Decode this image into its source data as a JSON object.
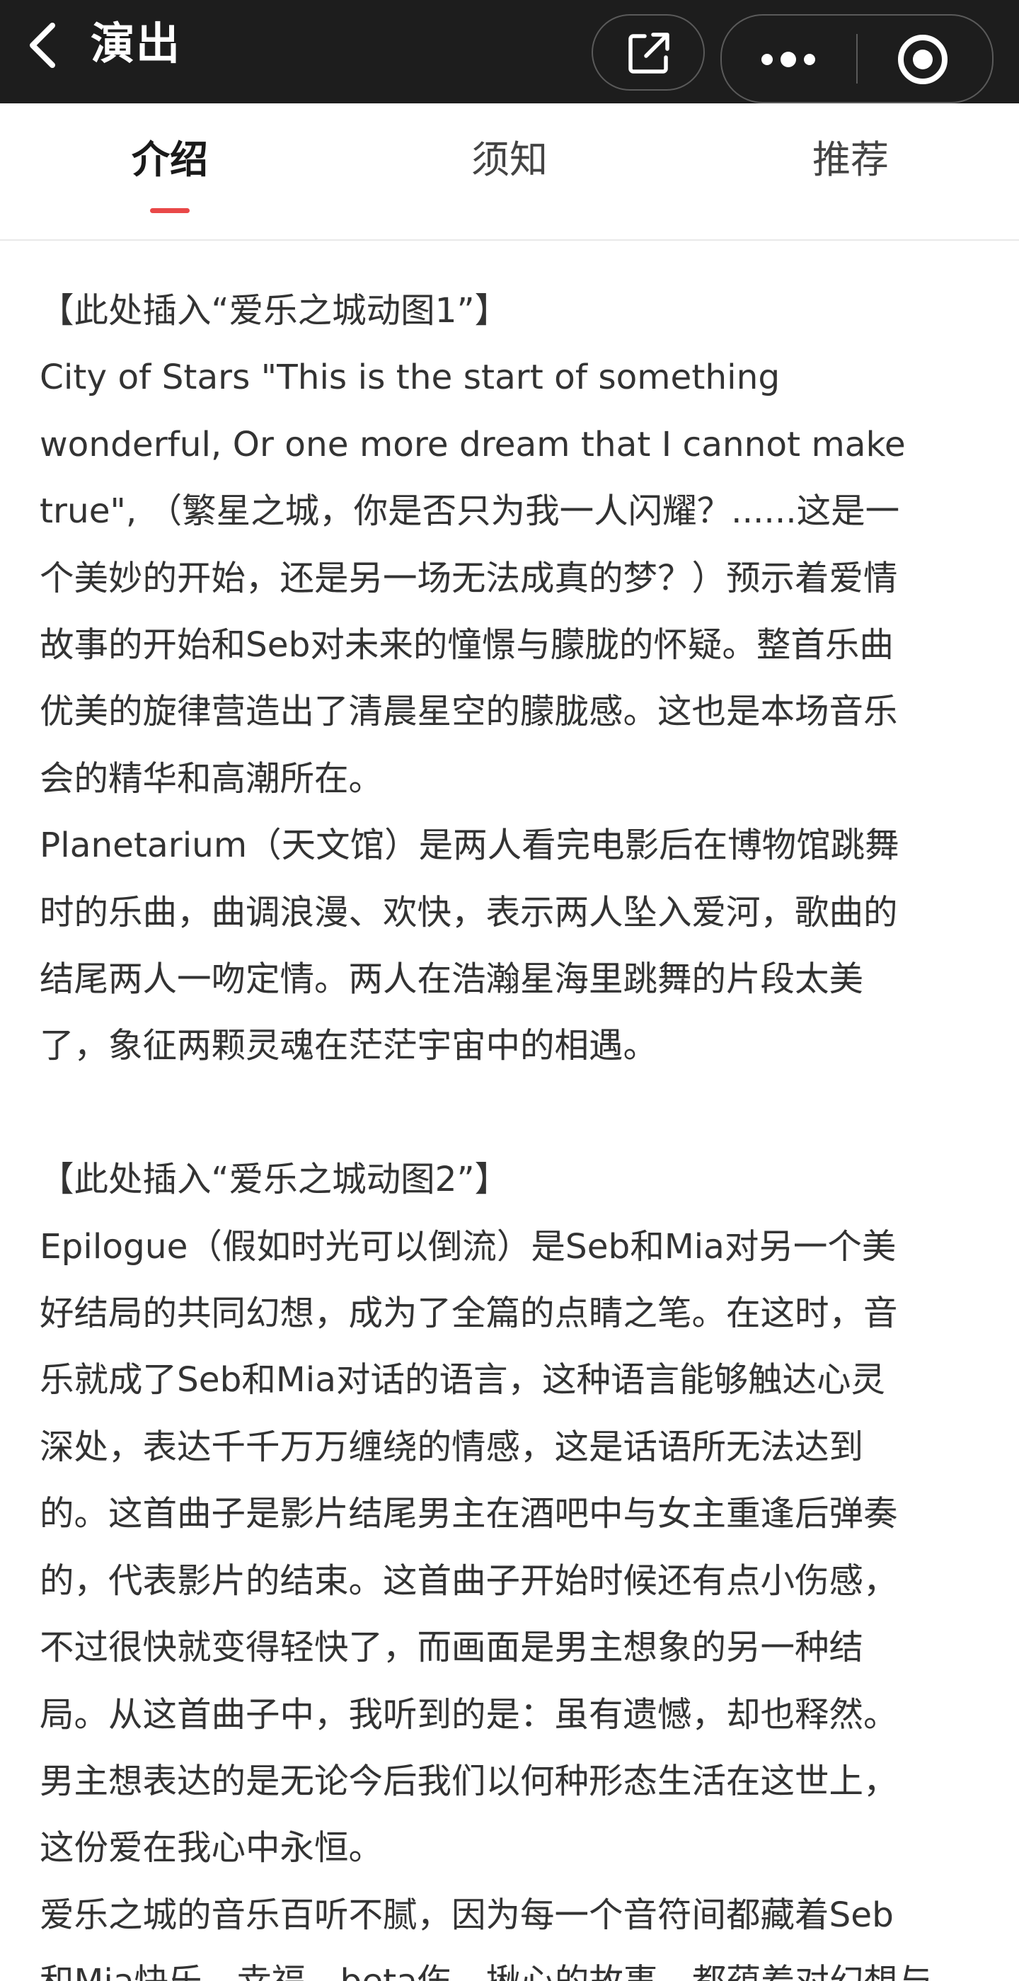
{
  "nav": {
    "title": "演出",
    "back_icon": "chevron-left-icon",
    "share_icon": "share-external-icon",
    "more_icon": "more-dots-icon",
    "close_icon": "target-close-icon"
  },
  "tabs": [
    {
      "label": "介绍",
      "active": true
    },
    {
      "label": "须知",
      "active": false
    },
    {
      "label": "推荐",
      "active": false
    }
  ],
  "colors": {
    "nav_background": "#1d1d1d",
    "active_tab_underline": "#e94848",
    "body_text": "#333333"
  },
  "article": {
    "placeholder1": " 【此处插入“爱乐之城动图1”】",
    "para1": "City of Stars \"This is the start of something\nwonderful, Or one more dream that I cannot make\ntrue\", （繁星之城，你是否只为我一人闪耀？......这是一\n个美妙的开始，还是另一场无法成真的梦？）预示着爱情\n故事的开始和Seb对未来的憧憬与朦胧的怀疑。整首乐曲\n优美的旋律营造出了清晨星空的朦胧感。这也是本场音乐\n会的精华和高潮所在。",
    "para2": "Planetarium（天文馆）是两人看完电影后在博物馆跳舞\n时的乐曲，曲调浪漫、欢快，表示两人坠入爱河，歌曲的\n结尾两人一吻定情。两人在浩瀚星海里跳舞的片段太美\n了，象征两颗灵魂在茫茫宇宙中的相遇。",
    "placeholder2": " 【此处插入“爱乐之城动图2”】",
    "para3": "Epilogue（假如时光可以倒流）是Seb和Mia对另一个美\n好结局的共同幻想，成为了全篇的点睛之笔。在这时，音\n乐就成了Seb和Mia对话的语言，这种语言能够触达心灵\n深处，表达千千万万缠绕的情感，这是话语所无法达到\n的。这首曲子是影片结尾男主在酒吧中与女主重逢后弹奏\n的，代表影片的结束。这首曲子开始时候还有点小伤感，\n不过很快就变得轻快了，而画面是男主想象的另一种结\n局。从这首曲子中，我听到的是：虽有遗憾，却也释然。\n男主想表达的是无论今后我们以何种形态生活在这世上，\n这份爱在我心中永恒。",
    "para4": "爱乐之城的音乐百听不腻，因为每一个音符间都藏着Seb\n和Mia快乐、幸福、beta伤、揪心的故事，都蕴着对幻想与"
  }
}
